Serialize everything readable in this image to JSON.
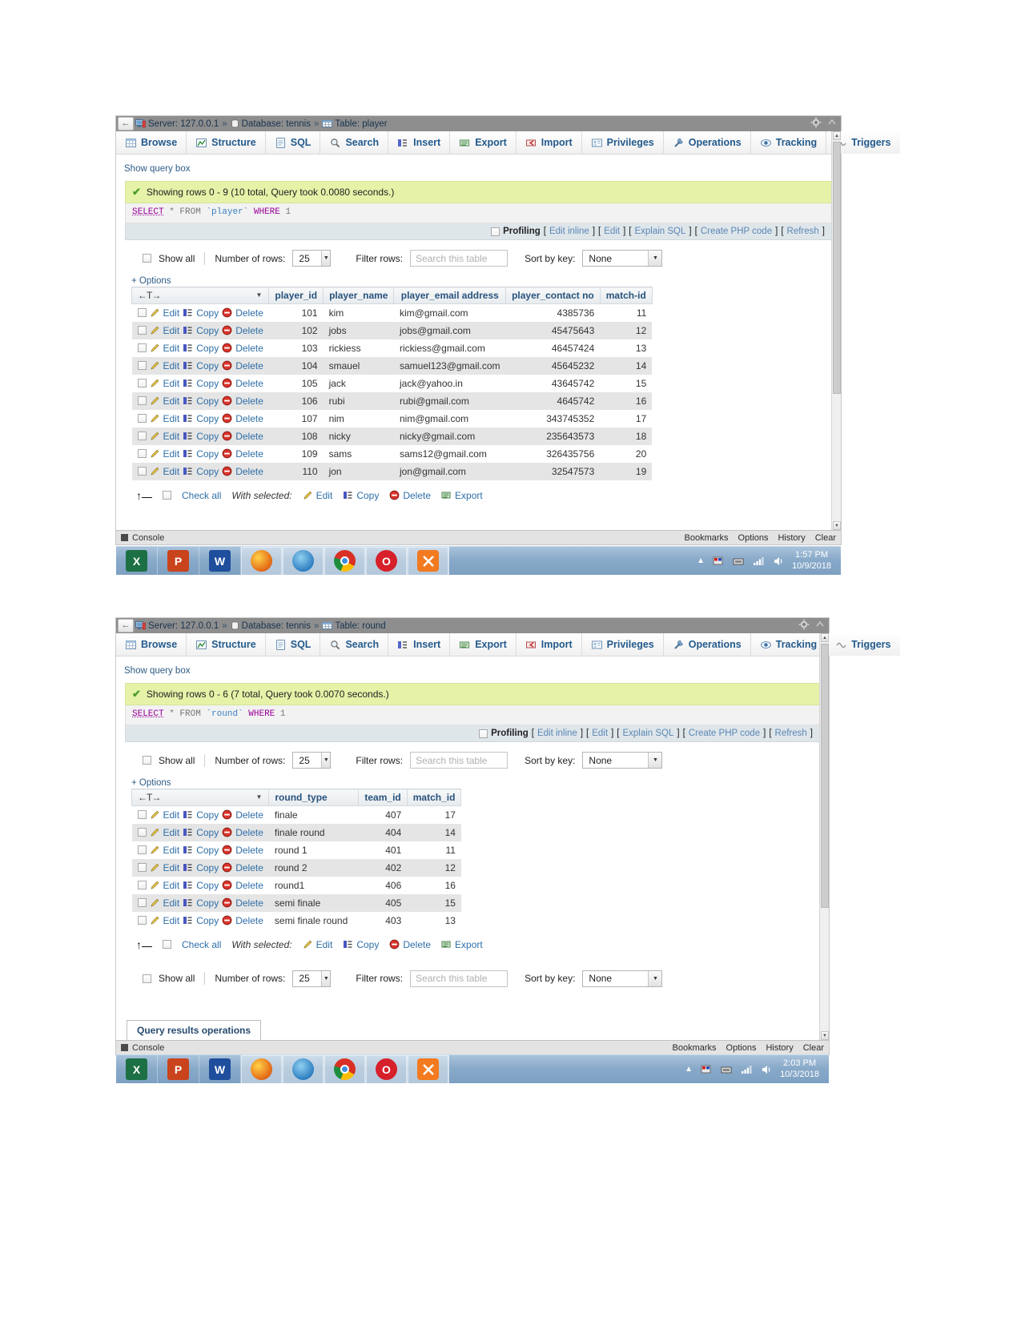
{
  "window1": {
    "titlebar": {
      "back_label": "←",
      "server_label": "Server: 127.0.0.1",
      "database_label": "Database: tennis",
      "table_label": "Table: player",
      "separator": "»"
    },
    "tabs": [
      {
        "label": "Browse",
        "icon": "browse-icon"
      },
      {
        "label": "Structure",
        "icon": "structure-icon"
      },
      {
        "label": "SQL",
        "icon": "sql-icon"
      },
      {
        "label": "Search",
        "icon": "search-icon"
      },
      {
        "label": "Insert",
        "icon": "insert-icon"
      },
      {
        "label": "Export",
        "icon": "export-icon"
      },
      {
        "label": "Import",
        "icon": "import-icon"
      },
      {
        "label": "Privileges",
        "icon": "privileges-icon"
      },
      {
        "label": "Operations",
        "icon": "operations-icon"
      },
      {
        "label": "Tracking",
        "icon": "tracking-icon"
      },
      {
        "label": "Triggers",
        "icon": "triggers-icon"
      }
    ],
    "show_query_box": "Show query box",
    "status": "Showing rows 0 - 9 (10 total, Query took 0.0080 seconds.)",
    "sql": {
      "select": "SELECT",
      "rest1": "* FROM",
      "table": "`player`",
      "where": "WHERE",
      "one": "1"
    },
    "profiling": {
      "label": "Profiling",
      "links": [
        "Edit inline",
        "Edit",
        "Explain SQL",
        "Create PHP code",
        "Refresh"
      ]
    },
    "controls": {
      "show_all": "Show all",
      "number_of_rows_label": "Number of rows:",
      "number_of_rows_value": "25",
      "filter_rows_label": "Filter rows:",
      "filter_rows_placeholder": "Search this table",
      "sort_by_key_label": "Sort by key:",
      "sort_by_key_value": "None"
    },
    "options_label": "+ Options",
    "table": {
      "sort_header": "←T→",
      "columns": [
        "player_id",
        "player_name",
        "player_email address",
        "player_contact no",
        "match-id"
      ],
      "row_actions": [
        "Edit",
        "Copy",
        "Delete"
      ],
      "rows": [
        {
          "player_id": "101",
          "player_name": "kim",
          "email": "kim@gmail.com",
          "contact": "4385736",
          "match_id": "11"
        },
        {
          "player_id": "102",
          "player_name": "jobs",
          "email": "jobs@gmail.com",
          "contact": "45475643",
          "match_id": "12"
        },
        {
          "player_id": "103",
          "player_name": "rickiess",
          "email": "rickiess@gmail.com",
          "contact": "46457424",
          "match_id": "13"
        },
        {
          "player_id": "104",
          "player_name": "smauel",
          "email": "samuel123@gmail.com",
          "contact": "45645232",
          "match_id": "14"
        },
        {
          "player_id": "105",
          "player_name": "jack",
          "email": "jack@yahoo.in",
          "contact": "43645742",
          "match_id": "15"
        },
        {
          "player_id": "106",
          "player_name": "rubi",
          "email": "rubi@gmail.com",
          "contact": "4645742",
          "match_id": "16"
        },
        {
          "player_id": "107",
          "player_name": "nim",
          "email": "nim@gmail.com",
          "contact": "343745352",
          "match_id": "17"
        },
        {
          "player_id": "108",
          "player_name": "nicky",
          "email": "nicky@gmail.com",
          "contact": "235643573",
          "match_id": "18"
        },
        {
          "player_id": "109",
          "player_name": "sams",
          "email": "sams12@gmail.com",
          "contact": "326435756",
          "match_id": "20"
        },
        {
          "player_id": "110",
          "player_name": "jon",
          "email": "jon@gmail.com",
          "contact": "32547573",
          "match_id": "19"
        }
      ]
    },
    "footer": {
      "check_all": "Check all",
      "with_selected": "With selected:",
      "actions": [
        "Edit",
        "Copy",
        "Delete",
        "Export"
      ]
    },
    "console": {
      "label": "Console",
      "right_items": [
        "Bookmarks",
        "Options",
        "History",
        "Clear"
      ]
    }
  },
  "window2": {
    "titlebar": {
      "back_label": "←",
      "server_label": "Server: 127.0.0.1",
      "database_label": "Database: tennis",
      "table_label": "Table: round",
      "separator": "»"
    },
    "tabs": [
      {
        "label": "Browse",
        "icon": "browse-icon"
      },
      {
        "label": "Structure",
        "icon": "structure-icon"
      },
      {
        "label": "SQL",
        "icon": "sql-icon"
      },
      {
        "label": "Search",
        "icon": "search-icon"
      },
      {
        "label": "Insert",
        "icon": "insert-icon"
      },
      {
        "label": "Export",
        "icon": "export-icon"
      },
      {
        "label": "Import",
        "icon": "import-icon"
      },
      {
        "label": "Privileges",
        "icon": "privileges-icon"
      },
      {
        "label": "Operations",
        "icon": "operations-icon"
      },
      {
        "label": "Tracking",
        "icon": "tracking-icon"
      },
      {
        "label": "Triggers",
        "icon": "triggers-icon"
      }
    ],
    "show_query_box": "Show query box",
    "status": "Showing rows 0 - 6 (7 total, Query took 0.0070 seconds.)",
    "sql": {
      "select": "SELECT",
      "rest1": "* FROM",
      "table": "`round`",
      "where": "WHERE",
      "one": "1"
    },
    "profiling": {
      "label": "Profiling",
      "links": [
        "Edit inline",
        "Edit",
        "Explain SQL",
        "Create PHP code",
        "Refresh"
      ]
    },
    "controls": {
      "show_all": "Show all",
      "number_of_rows_label": "Number of rows:",
      "number_of_rows_value": "25",
      "filter_rows_label": "Filter rows:",
      "filter_rows_placeholder": "Search this table",
      "sort_by_key_label": "Sort by key:",
      "sort_by_key_value": "None"
    },
    "options_label": "+ Options",
    "table": {
      "sort_header": "←T→",
      "columns": [
        "round_type",
        "team_id",
        "match_id"
      ],
      "row_actions": [
        "Edit",
        "Copy",
        "Delete"
      ],
      "rows": [
        {
          "round_type": "finale",
          "team_id": "407",
          "match_id": "17"
        },
        {
          "round_type": "finale round",
          "team_id": "404",
          "match_id": "14"
        },
        {
          "round_type": "round 1",
          "team_id": "401",
          "match_id": "11"
        },
        {
          "round_type": "round 2",
          "team_id": "402",
          "match_id": "12"
        },
        {
          "round_type": "round1",
          "team_id": "406",
          "match_id": "16"
        },
        {
          "round_type": "semi finale",
          "team_id": "405",
          "match_id": "15"
        },
        {
          "round_type": "semi finale round",
          "team_id": "403",
          "match_id": "13"
        }
      ]
    },
    "footer": {
      "check_all": "Check all",
      "with_selected": "With selected:",
      "actions": [
        "Edit",
        "Copy",
        "Delete",
        "Export"
      ]
    },
    "query_results_operations": "Query results operations",
    "console": {
      "label": "Console",
      "right_items": [
        "Bookmarks",
        "Options",
        "History",
        "Clear"
      ]
    }
  },
  "taskbar1": {
    "apps": [
      {
        "name": "excel",
        "glyph": "X",
        "color": "#1d7044"
      },
      {
        "name": "powerpoint",
        "glyph": "P",
        "color": "#c9431d"
      },
      {
        "name": "word",
        "glyph": "W",
        "color": "#1f4e9c"
      },
      {
        "name": "firefox",
        "glyph": "",
        "color": "#e8761b"
      },
      {
        "name": "thunderbird",
        "glyph": "",
        "color": "#2f7fc1"
      },
      {
        "name": "chrome",
        "glyph": "",
        "color": "#3b8ee0"
      },
      {
        "name": "opera",
        "glyph": "O",
        "color": "#d6202a"
      },
      {
        "name": "xampp",
        "glyph": "",
        "color": "#f37a1f"
      }
    ],
    "clock_time": "1:57 PM",
    "clock_date": "10/9/2018"
  },
  "taskbar2": {
    "apps": [
      {
        "name": "excel",
        "glyph": "X",
        "color": "#1d7044"
      },
      {
        "name": "powerpoint",
        "glyph": "P",
        "color": "#c9431d"
      },
      {
        "name": "word",
        "glyph": "W",
        "color": "#1f4e9c"
      },
      {
        "name": "firefox",
        "glyph": "",
        "color": "#e8761b"
      },
      {
        "name": "thunderbird",
        "glyph": "",
        "color": "#2f7fc1"
      },
      {
        "name": "chrome",
        "glyph": "",
        "color": "#3b8ee0"
      },
      {
        "name": "opera",
        "glyph": "O",
        "color": "#d6202a"
      },
      {
        "name": "xampp",
        "glyph": "",
        "color": "#f37a1f"
      }
    ],
    "clock_time": "2:03 PM",
    "clock_date": "10/3/2018"
  },
  "colors": {
    "accent_link": "#2f6fa8",
    "success_bg": "#e5f2a8",
    "header_blue": "#28537d",
    "taskbar": "#89aac9"
  }
}
